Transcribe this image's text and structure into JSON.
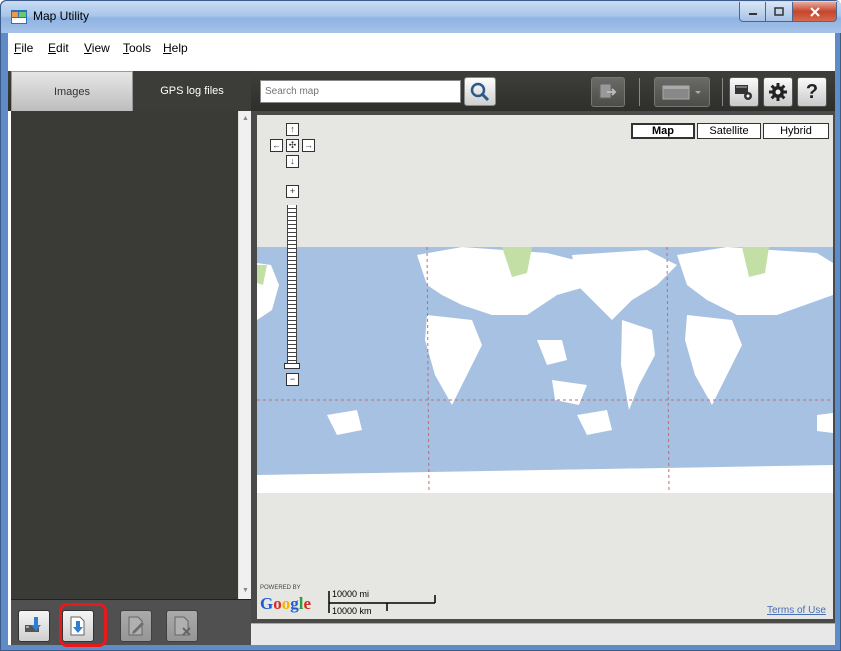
{
  "window": {
    "title": "Map Utility",
    "controls": [
      "minimize-icon",
      "maximize-icon",
      "close-icon"
    ]
  },
  "menu": {
    "items": [
      {
        "label": "File",
        "accel": "F",
        "rest": "ile"
      },
      {
        "label": "Edit",
        "accel": "E",
        "rest": "dit"
      },
      {
        "label": "View",
        "accel": "V",
        "rest": "iew"
      },
      {
        "label": "Tools",
        "accel": "T",
        "rest": "ools"
      },
      {
        "label": "Help",
        "accel": "H",
        "rest": "elp"
      }
    ]
  },
  "tabs": {
    "images_label": "Images",
    "gps_label": "GPS log files",
    "active": "GPS log files"
  },
  "search": {
    "placeholder": "Search map",
    "value": ""
  },
  "toolbar": {
    "icons": [
      "search-icon",
      "export-icon",
      "window-dropdown-icon",
      "tools-settings-icon",
      "gear-icon",
      "help-icon"
    ],
    "help_label": "?"
  },
  "map": {
    "type_buttons": [
      "Map",
      "Satellite",
      "Hybrid"
    ],
    "selected_type": "Map",
    "scale_mi": "10000 mi",
    "scale_km": "10000 km",
    "powered_by": "POWERED BY",
    "google_logo": "Google",
    "terms_label": "Terms of Use",
    "zoom_level": 0
  },
  "bottom_buttons": {
    "icons": [
      "import-images-icon",
      "import-log-icon",
      "edit-icon",
      "delete-icon"
    ],
    "highlighted": "import-log-icon"
  },
  "colors": {
    "dark_panel": "#3a3b36",
    "ocean": "#a6c1e1",
    "land": "#ffffff",
    "highlight": "#e8181b",
    "link": "#4a6fb5"
  }
}
